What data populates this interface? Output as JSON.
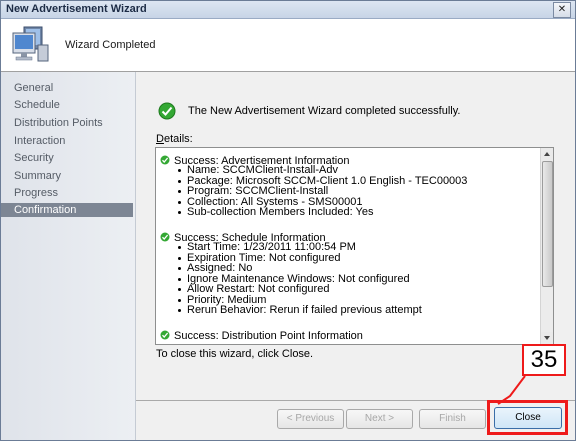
{
  "window": {
    "title": "New Advertisement Wizard",
    "close_glyph": "✕"
  },
  "header": {
    "title": "Wizard Completed",
    "icon": "computer-monitor-icon"
  },
  "sidebar": {
    "items": [
      {
        "label": "General"
      },
      {
        "label": "Schedule"
      },
      {
        "label": "Distribution Points"
      },
      {
        "label": "Interaction"
      },
      {
        "label": "Security"
      },
      {
        "label": "Summary"
      },
      {
        "label": "Progress"
      },
      {
        "label": "Confirmation",
        "active": true
      }
    ]
  },
  "main": {
    "success_message": "The New Advertisement Wizard completed successfully.",
    "details_label_prefix": "D",
    "details_label_rest": "etails:",
    "details": [
      {
        "title": "Success: Advertisement Information",
        "items": [
          "Name: SCCMClient-Install-Adv",
          "Package: Microsoft SCCM-Client 1.0 English - TEC00003",
          "Program: SCCMClient-Install",
          "Collection: All Systems - SMS00001",
          "Sub-collection Members Included: Yes"
        ]
      },
      {
        "title": "Success: Schedule Information",
        "items": [
          "Start Time: 1/23/2011 11:00:54 PM",
          "Expiration Time: Not configured",
          "Assigned: No",
          "Ignore Maintenance Windows: Not configured",
          "Allow Restart: Not configured",
          "Priority: Medium",
          "Rerun Behavior: Rerun if failed previous attempt"
        ]
      },
      {
        "title": "Success: Distribution Point Information",
        "items": []
      }
    ],
    "close_hint": "To close this wizard, click Close."
  },
  "footer": {
    "previous_label": "< Previous",
    "next_label": "Next >",
    "finish_label": "Finish",
    "close_label": "Close"
  },
  "annotation": {
    "callout_number": "35"
  },
  "colors": {
    "highlight": "#ee1a1a",
    "active_nav": "#7d8694",
    "success_green": "#2a9a2a"
  }
}
